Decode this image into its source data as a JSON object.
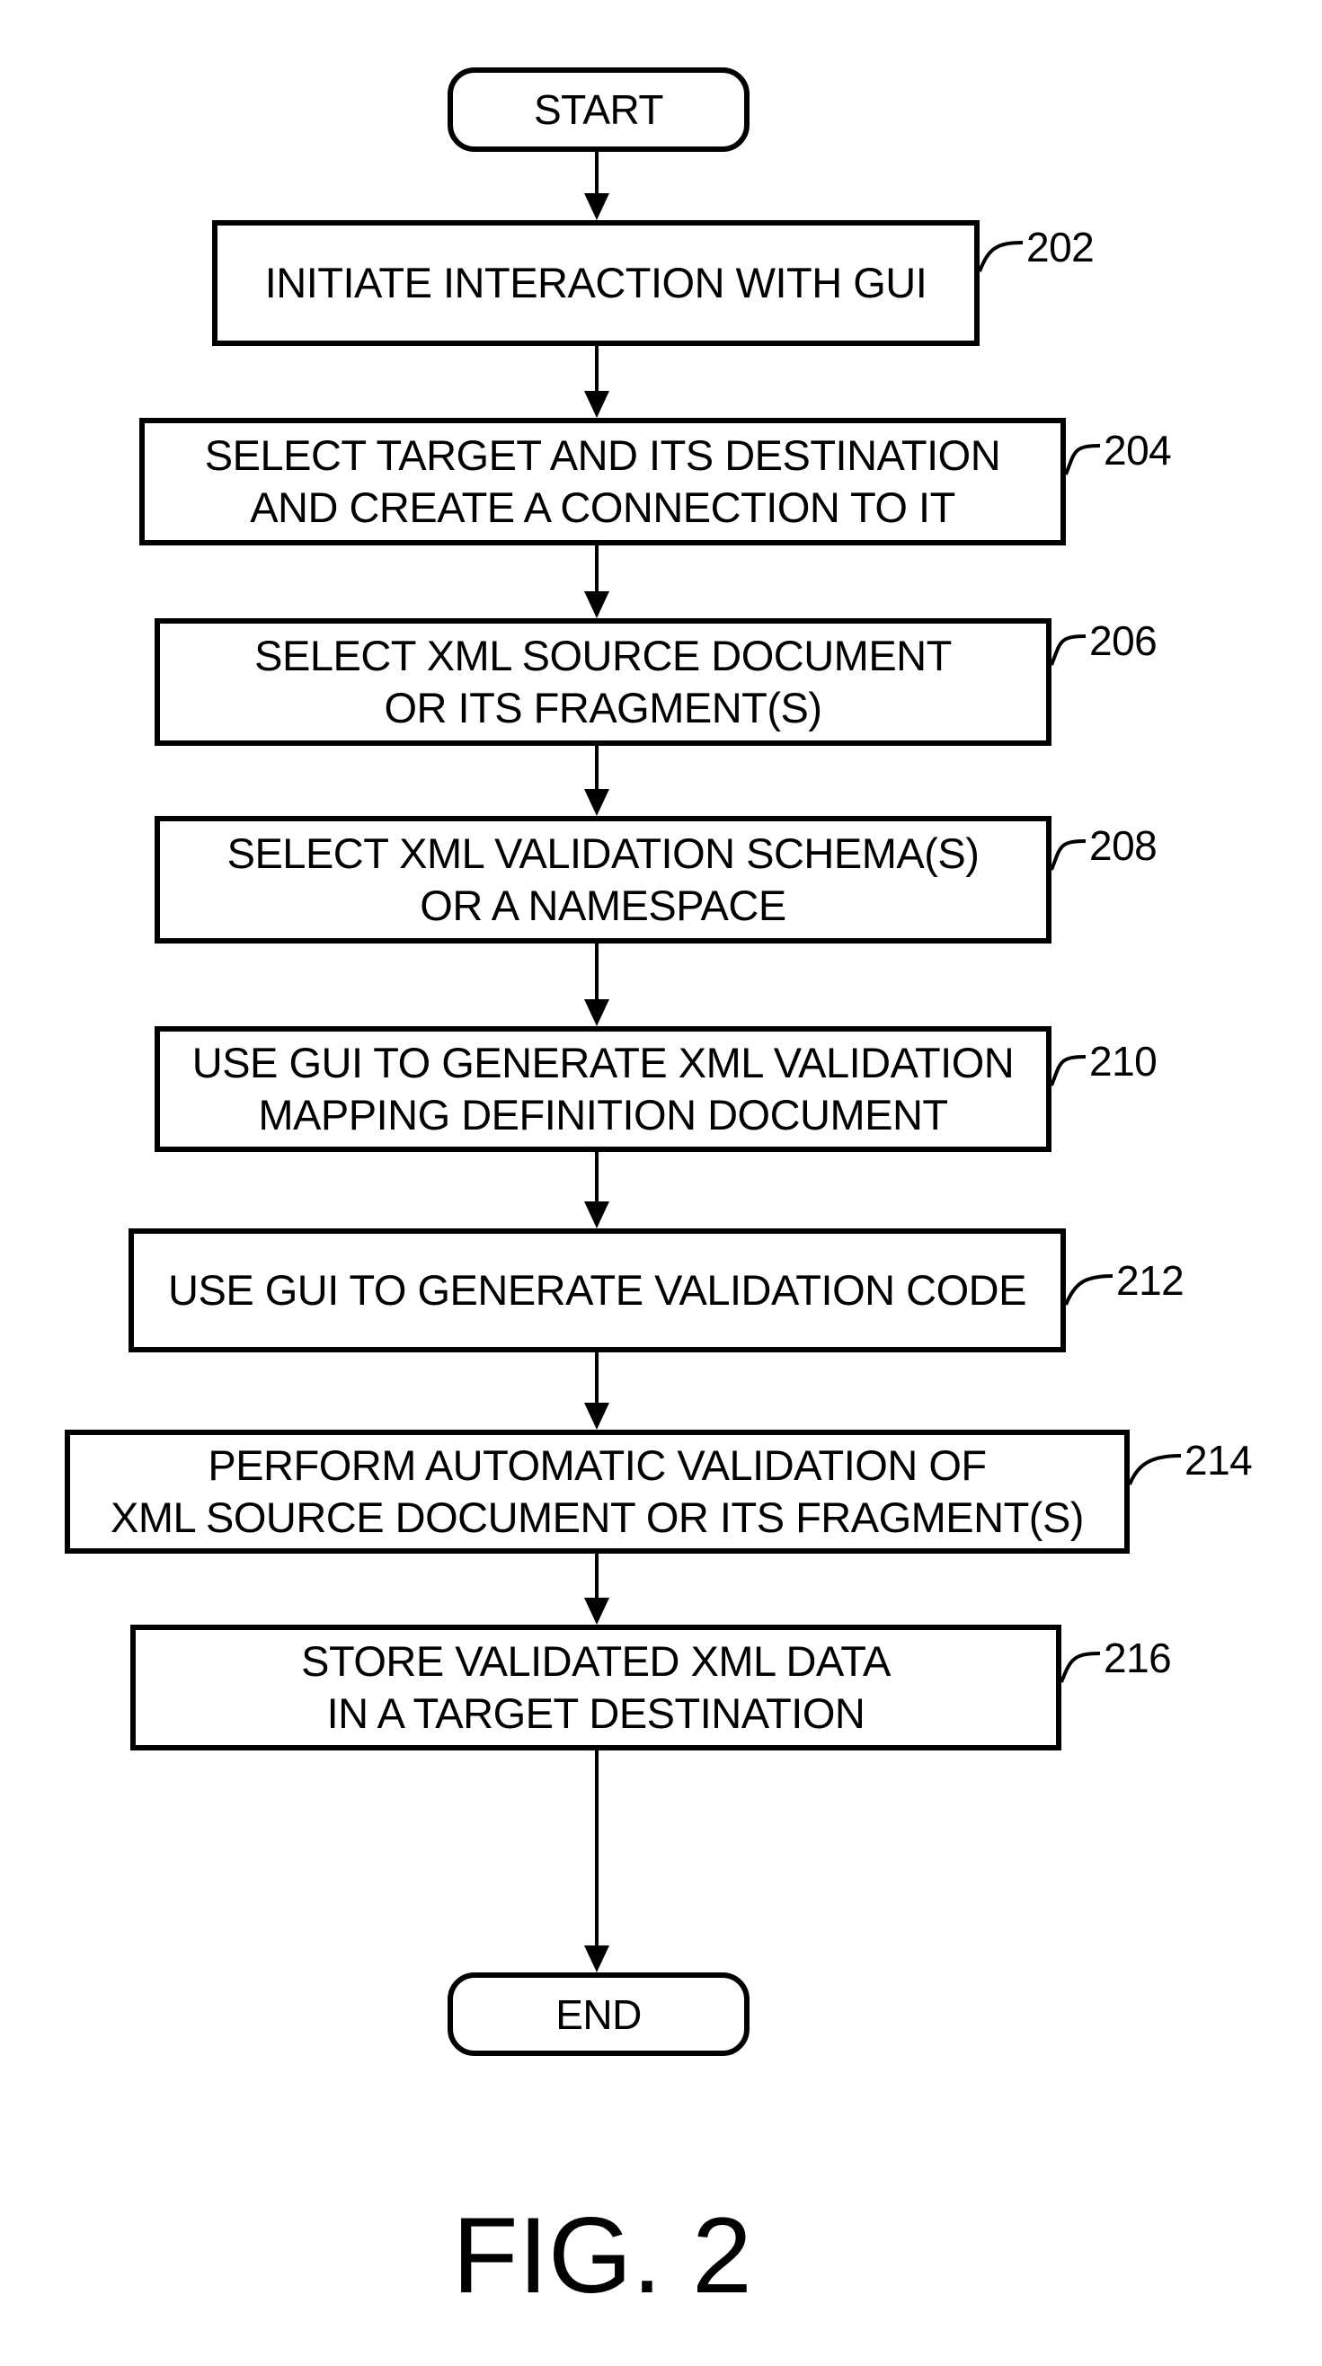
{
  "figure": {
    "caption": "FIG. 2"
  },
  "flowchart": {
    "start": {
      "label": "START"
    },
    "end": {
      "label": "END"
    },
    "steps": [
      {
        "ref": "202",
        "lines": [
          "INITIATE INTERACTION WITH GUI"
        ]
      },
      {
        "ref": "204",
        "lines": [
          "SELECT TARGET AND ITS DESTINATION",
          "AND CREATE A CONNECTION TO IT"
        ]
      },
      {
        "ref": "206",
        "lines": [
          "SELECT XML SOURCE DOCUMENT",
          "OR ITS FRAGMENT(S)"
        ]
      },
      {
        "ref": "208",
        "lines": [
          "SELECT XML VALIDATION SCHEMA(S)",
          "OR A NAMESPACE"
        ]
      },
      {
        "ref": "210",
        "lines": [
          "USE GUI TO GENERATE XML VALIDATION",
          "MAPPING DEFINITION DOCUMENT"
        ]
      },
      {
        "ref": "212",
        "lines": [
          "USE GUI TO GENERATE VALIDATION CODE"
        ]
      },
      {
        "ref": "214",
        "lines": [
          "PERFORM AUTOMATIC VALIDATION OF",
          "XML SOURCE DOCUMENT OR ITS FRAGMENT(S)"
        ]
      },
      {
        "ref": "216",
        "lines": [
          "STORE VALIDATED XML DATA",
          "IN A TARGET DESTINATION"
        ]
      }
    ]
  }
}
